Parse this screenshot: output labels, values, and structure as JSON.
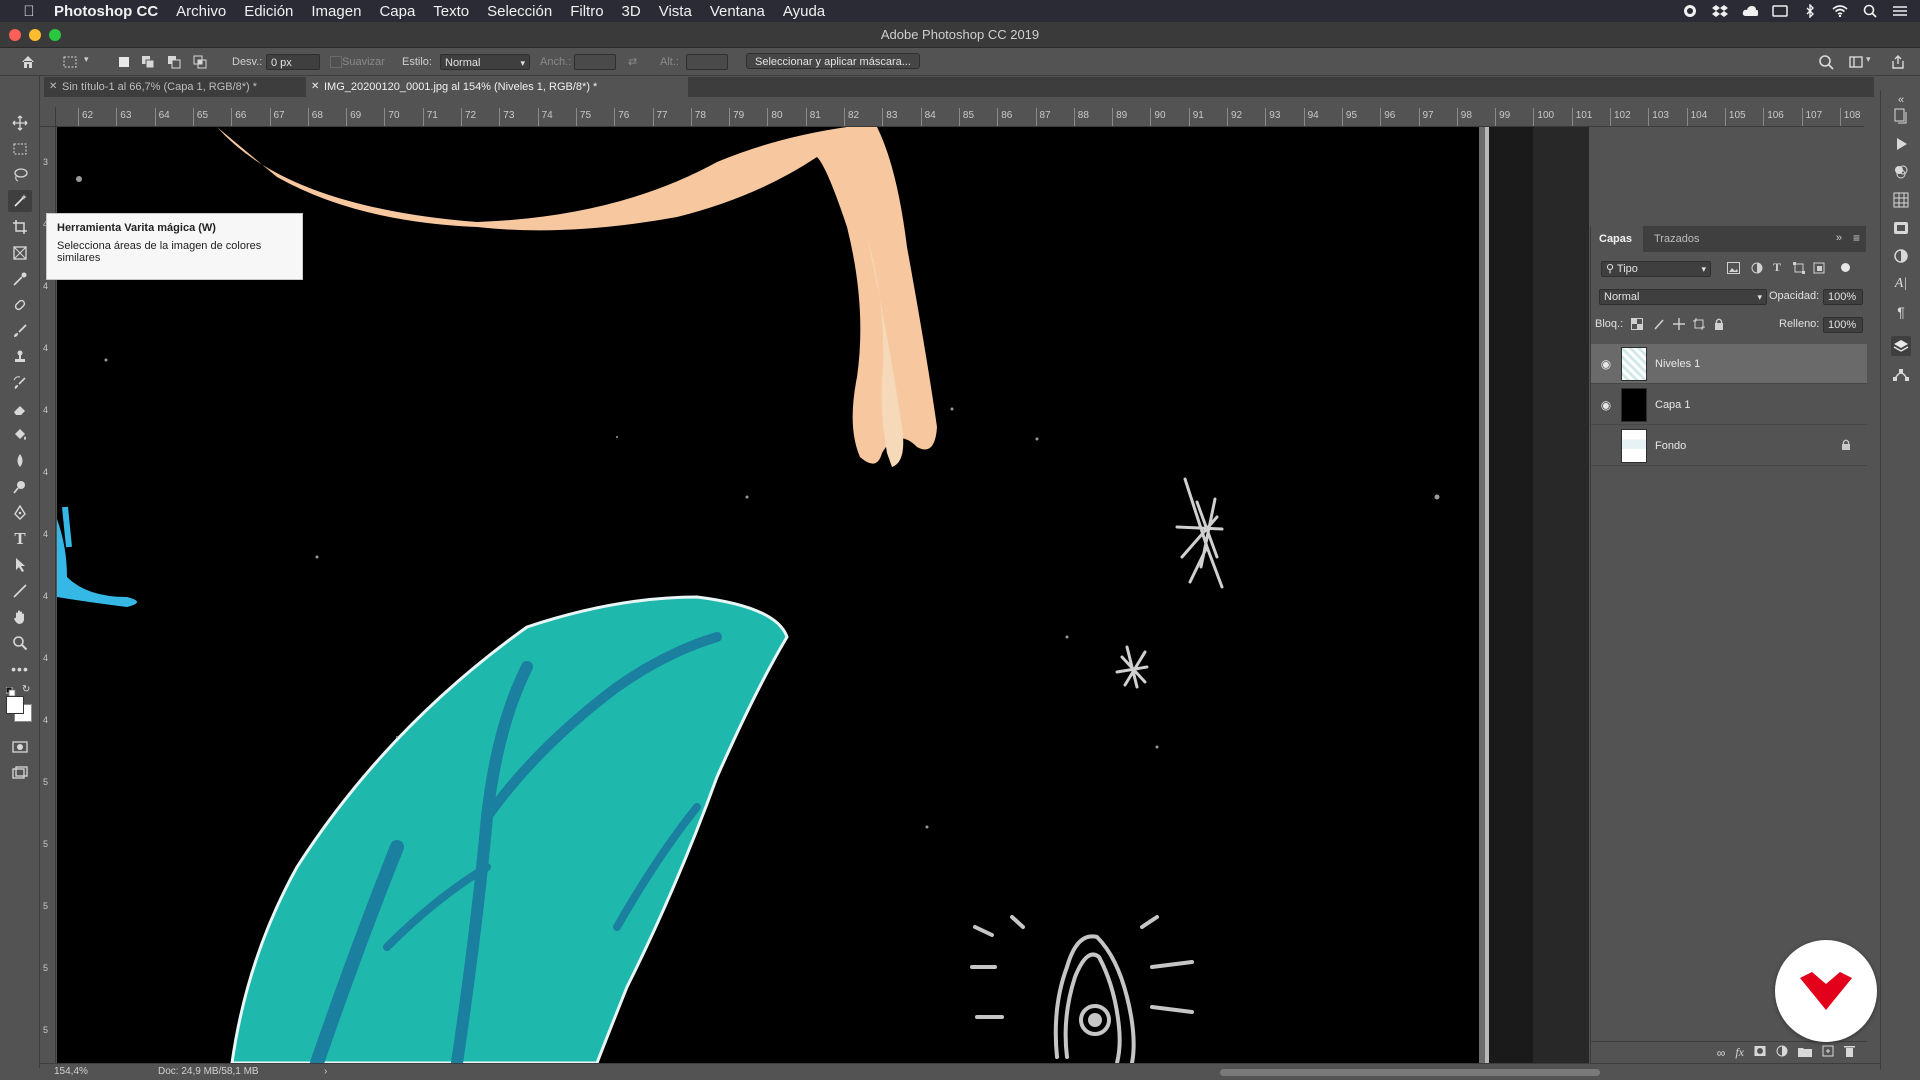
{
  "menubar": {
    "app_name": "Photoshop CC",
    "menus": [
      "Archivo",
      "Edición",
      "Imagen",
      "Capa",
      "Texto",
      "Selección",
      "Filtro",
      "3D",
      "Vista",
      "Ventana",
      "Ayuda"
    ]
  },
  "window": {
    "title": "Adobe Photoshop CC 2019"
  },
  "options": {
    "desv_label": "Desv.:",
    "desv_value": "0 px",
    "suavizar_label": "Suavizar",
    "estilo_label": "Estilo:",
    "estilo_value": "Normal",
    "anch_label": "Anch.:",
    "alt_label": "Alt.:",
    "mask_button": "Seleccionar y aplicar máscara..."
  },
  "tabs": [
    {
      "label": "Sin título-1 al 66,7% (Capa 1, RGB/8*) *",
      "active": false
    },
    {
      "label": "IMG_20200120_0001.jpg al 154% (Niveles 1, RGB/8*) *",
      "active": true
    }
  ],
  "ruler": {
    "top": [
      "62",
      "63",
      "64",
      "65",
      "66",
      "67",
      "68",
      "69",
      "70",
      "71",
      "72",
      "73",
      "74",
      "75",
      "76",
      "77",
      "78",
      "79",
      "80",
      "81",
      "82",
      "83",
      "84",
      "85",
      "86",
      "87",
      "88",
      "89",
      "90",
      "91",
      "92",
      "93",
      "94",
      "95",
      "96",
      "97",
      "98",
      "99",
      "100",
      "101",
      "102",
      "103",
      "104",
      "105",
      "106",
      "107",
      "108"
    ],
    "left": [
      "3",
      "4",
      "4",
      "4",
      "4",
      "4",
      "4",
      "4",
      "4",
      "4",
      "5",
      "5",
      "5",
      "5",
      "5"
    ]
  },
  "tooltip": {
    "title": "Herramienta Varita mágica (W)",
    "description": "Selecciona áreas de la imagen de colores similares"
  },
  "layers_panel": {
    "tabs": [
      "Capas",
      "Trazados"
    ],
    "filter_label": "Tipo",
    "blend_mode": "Normal",
    "opacity_label": "Opacidad:",
    "opacity_value": "100%",
    "lock_label": "Bloq.:",
    "fill_label": "Relleno:",
    "fill_value": "100%",
    "layers": [
      {
        "name": "Niveles 1",
        "visible": true,
        "selected": true
      },
      {
        "name": "Capa 1",
        "visible": true,
        "selected": false
      },
      {
        "name": "Fondo",
        "visible": false,
        "selected": false,
        "locked": true
      }
    ]
  },
  "status": {
    "zoom": "154,4%",
    "doc": "Doc: 24,9 MB/58,1 MB"
  },
  "colors": {
    "menubar_bg": "#2b2b36",
    "ui_bg": "#535353",
    "canvas_bg": "#000000",
    "leaf": "#1fb8ad",
    "leaf_vein": "#1b7fa0",
    "skin": "#f7c8a0",
    "badge_red": "#e2001a"
  },
  "icons": {
    "apple": "apple-icon",
    "home": "home-icon",
    "search": "search-icon",
    "brand": "heart-chevron-logo"
  }
}
